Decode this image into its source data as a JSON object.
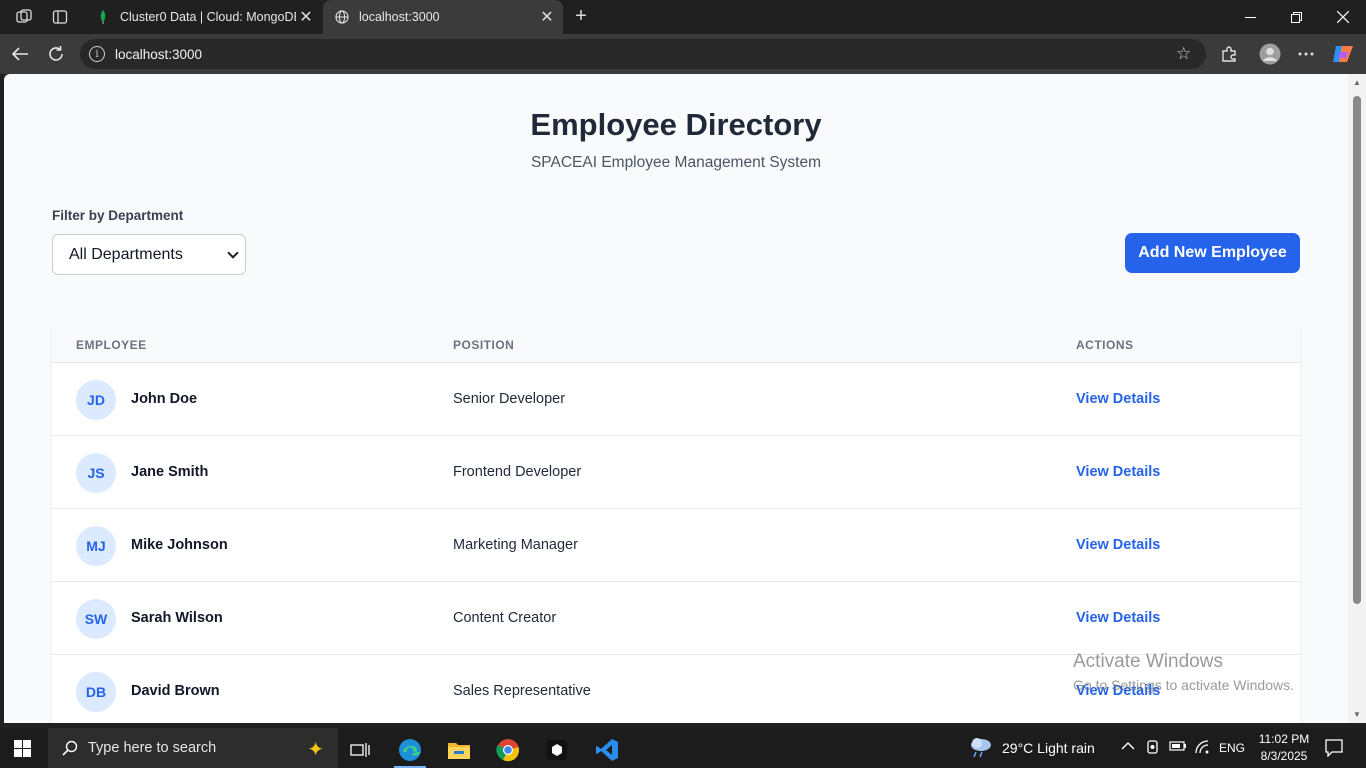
{
  "browser": {
    "tabs": [
      {
        "title": "Cluster0 Data | Cloud: MongoDB Cloud",
        "active": false
      },
      {
        "title": "localhost:3000",
        "active": true
      }
    ],
    "address": "localhost:3000"
  },
  "page": {
    "title": "Employee Directory",
    "subtitle": "SPACEAI Employee Management System",
    "filter": {
      "label": "Filter by Department",
      "selected": "All Departments"
    },
    "add_button": "Add New Employee",
    "table": {
      "headers": {
        "employee": "EMPLOYEE",
        "position": "POSITION",
        "actions": "ACTIONS"
      },
      "rows": [
        {
          "initials": "JD",
          "name": "John Doe",
          "position": "Senior Developer",
          "action": "View Details"
        },
        {
          "initials": "JS",
          "name": "Jane Smith",
          "position": "Frontend Developer",
          "action": "View Details"
        },
        {
          "initials": "MJ",
          "name": "Mike Johnson",
          "position": "Marketing Manager",
          "action": "View Details"
        },
        {
          "initials": "SW",
          "name": "Sarah Wilson",
          "position": "Content Creator",
          "action": "View Details"
        },
        {
          "initials": "DB",
          "name": "David Brown",
          "position": "Sales Representative",
          "action": "View Details"
        }
      ]
    }
  },
  "watermark": {
    "line1": "Activate Windows",
    "line2": "Go to Settings to activate Windows."
  },
  "taskbar": {
    "search_placeholder": "Type here to search",
    "weather": "29°C  Light rain",
    "language": "ENG",
    "time": "11:02 PM",
    "date": "8/3/2025"
  },
  "colors": {
    "accent": "#2563eb",
    "avatar_bg": "#dbeafe",
    "page_bg": "#f9fafb"
  }
}
